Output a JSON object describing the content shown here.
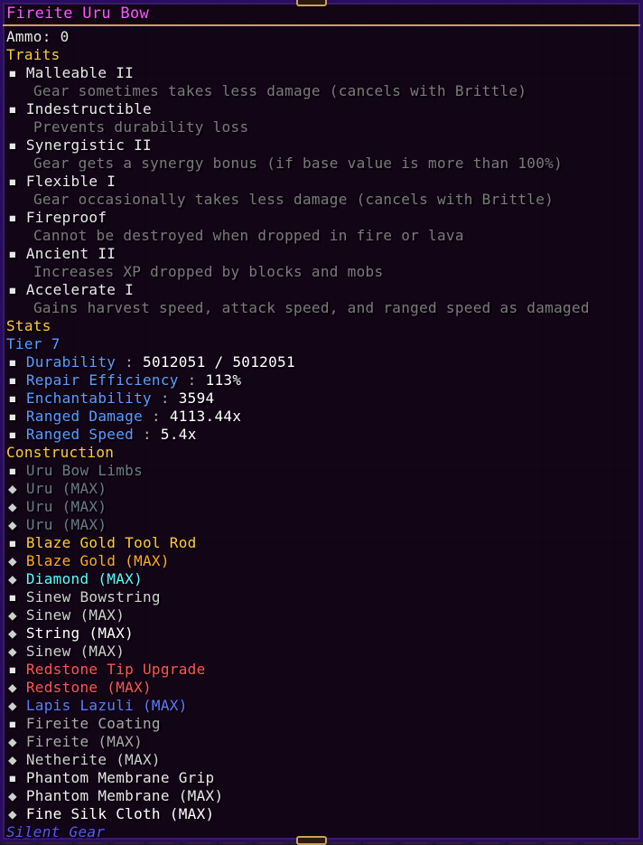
{
  "tooltip": {
    "title": "Fireite Uru Bow",
    "ammo": "Ammo: 0",
    "traits_header": "Traits",
    "traits": [
      {
        "name": "Malleable II",
        "desc": "Gear sometimes takes less damage (cancels with Brittle)"
      },
      {
        "name": "Indestructible",
        "desc": "Prevents durability loss"
      },
      {
        "name": "Synergistic II",
        "desc": "Gear gets a synergy bonus (if base value is more than 100%)"
      },
      {
        "name": "Flexible I",
        "desc": "Gear occasionally takes less damage (cancels with Brittle)"
      },
      {
        "name": "Fireproof",
        "desc": "Cannot be destroyed when dropped in fire or lava"
      },
      {
        "name": "Ancient II",
        "desc": "Increases XP dropped by blocks and mobs"
      },
      {
        "name": "Accelerate I",
        "desc": "Gains harvest speed, attack speed, and ranged speed as damaged"
      }
    ],
    "stats_header": "Stats",
    "tier": "Tier 7",
    "stats": [
      {
        "name": "Durability",
        "value": "5012051 / 5012051"
      },
      {
        "name": "Repair Efficiency",
        "value": "113%"
      },
      {
        "name": "Enchantability",
        "value": "3594"
      },
      {
        "name": "Ranged Damage",
        "value": "4113.44x"
      },
      {
        "name": "Ranged Speed",
        "value": "5.4x"
      }
    ],
    "stat_separator": ":",
    "construction_header": "Construction",
    "parts": [
      {
        "name": "Uru Bow Limbs",
        "color": "#6b7a86",
        "materials": [
          {
            "label": "Uru (MAX)",
            "color": "#6b7a86"
          },
          {
            "label": "Uru (MAX)",
            "color": "#6b7a86"
          },
          {
            "label": "Uru (MAX)",
            "color": "#6b7a86"
          }
        ]
      },
      {
        "name": "Blaze Gold Tool Rod",
        "color": "#ffcc33",
        "materials": [
          {
            "label": "Blaze Gold (MAX)",
            "color": "#ffaa22"
          },
          {
            "label": "Diamond (MAX)",
            "color": "#55ffff"
          }
        ]
      },
      {
        "name": "Sinew Bowstring",
        "color": "#cfcfcf",
        "materials": [
          {
            "label": "Sinew (MAX)",
            "color": "#cfcfcf"
          },
          {
            "label": "String (MAX)",
            "color": "#ffffff"
          },
          {
            "label": "Sinew (MAX)",
            "color": "#cfcfcf"
          }
        ]
      },
      {
        "name": "Redstone Tip Upgrade",
        "color": "#ff5555",
        "materials": [
          {
            "label": "Redstone (MAX)",
            "color": "#ff5555"
          },
          {
            "label": "Lapis Lazuli (MAX)",
            "color": "#5a7dff"
          }
        ]
      },
      {
        "name": "Fireite Coating",
        "color": "#a9a9a9",
        "materials": [
          {
            "label": "Fireite (MAX)",
            "color": "#a9a9a9"
          },
          {
            "label": "Netherite (MAX)",
            "color": "#cfcfcf"
          }
        ]
      },
      {
        "name": "Phantom Membrane Grip",
        "color": "#e8e8e8",
        "materials": [
          {
            "label": "Phantom Membrane (MAX)",
            "color": "#e8e8e8"
          },
          {
            "label": "Fine Silk Cloth (MAX)",
            "color": "#ffffff"
          }
        ]
      }
    ],
    "bullet": "▪",
    "sub_bullet": "◆",
    "footer": "Silent Gear"
  },
  "colors": {
    "title": "#ff55ff",
    "header": "#ffcc33",
    "trait_desc": "#7a7a7a",
    "stat_name": "#5a9cff",
    "tier": "#5a9cff",
    "footer": "#5555ff",
    "border_gold": "#c9a45a"
  }
}
